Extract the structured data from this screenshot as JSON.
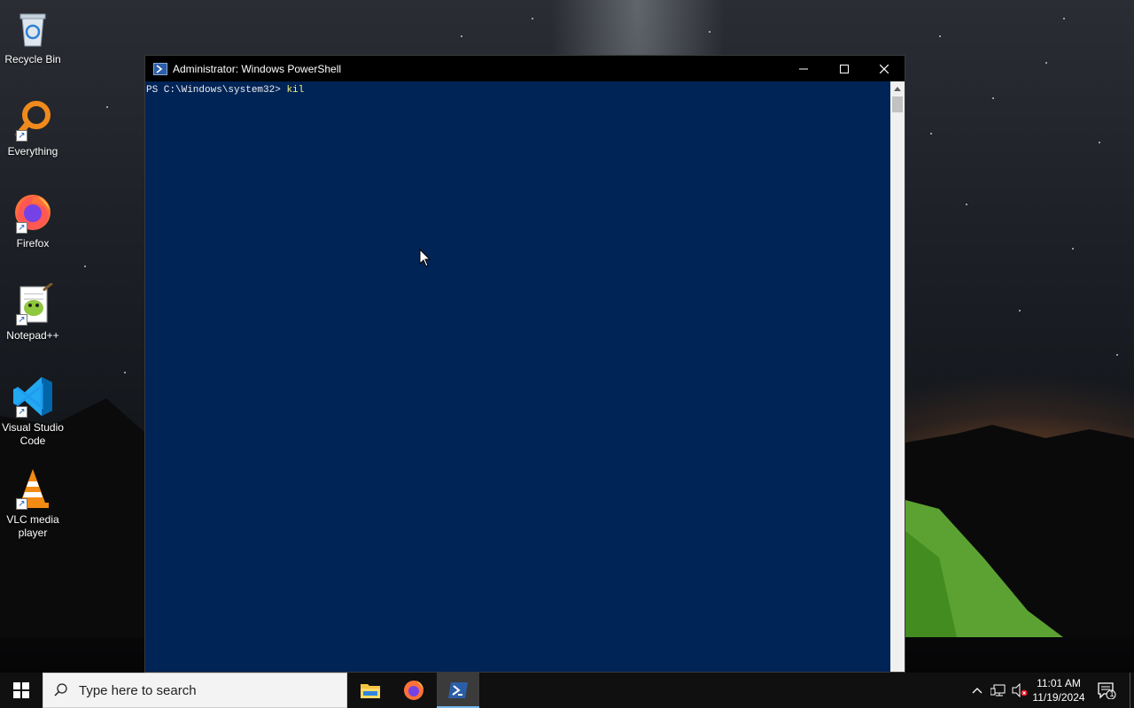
{
  "desktop": {
    "icons": [
      {
        "label": "Recycle Bin",
        "icon": "recycle-bin-icon"
      },
      {
        "label": "Everything",
        "icon": "everything-icon"
      },
      {
        "label": "Firefox",
        "icon": "firefox-icon"
      },
      {
        "label": "Notepad++",
        "icon": "notepadpp-icon"
      },
      {
        "label": "Visual Studio Code",
        "icon": "vscode-icon"
      },
      {
        "label": "VLC media player",
        "icon": "vlc-icon"
      }
    ]
  },
  "powershell": {
    "title": "Administrator: Windows PowerShell",
    "prompt": "PS C:\\Windows\\system32> ",
    "typed_command": "kil",
    "colors": {
      "background": "#012456",
      "text": "#eeedf0",
      "command": "#f4f47a"
    }
  },
  "taskbar": {
    "search_placeholder": "Type here to search",
    "apps": [
      {
        "name": "File Explorer",
        "icon": "file-explorer-icon",
        "active": false
      },
      {
        "name": "Firefox",
        "icon": "firefox-icon",
        "active": false
      },
      {
        "name": "Windows PowerShell",
        "icon": "powershell-icon",
        "active": true
      }
    ],
    "clock": {
      "time": "11:01 AM",
      "date": "11/19/2024"
    },
    "notification_count": "1"
  }
}
